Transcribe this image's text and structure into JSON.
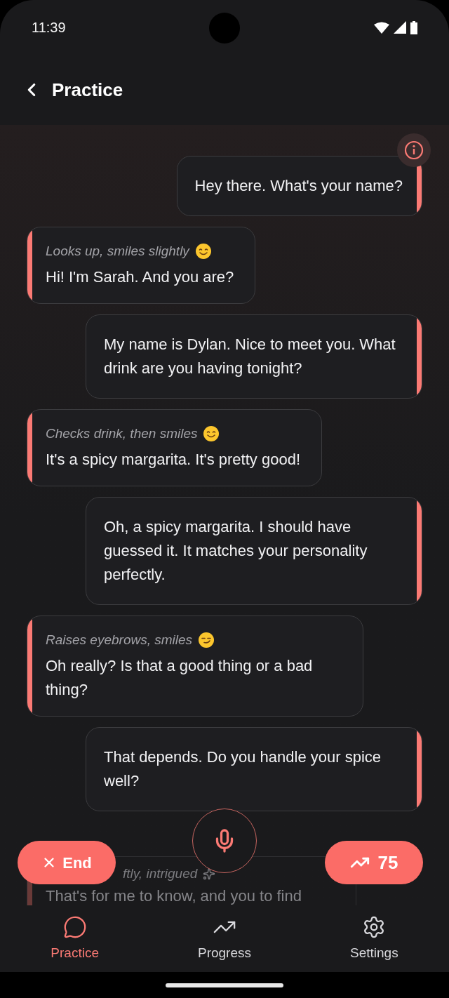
{
  "status_bar": {
    "time": "11:39"
  },
  "header": {
    "title": "Practice"
  },
  "messages": [
    {
      "kind": "sent",
      "text": "Hey there. What's your name?"
    },
    {
      "kind": "received",
      "note": {
        "kind": "smile",
        "text": "Looks up, smiles slightly"
      },
      "text": "Hi! I'm Sarah. And you are?"
    },
    {
      "kind": "sent",
      "text": "My name is Dylan. Nice to meet you. What drink are you having tonight?"
    },
    {
      "kind": "received",
      "note": {
        "kind": "smile",
        "text": "Checks drink, then smiles"
      },
      "text": "It's a spicy margarita. It's pretty good!"
    },
    {
      "kind": "sent",
      "text": "Oh, a spicy margarita. I should have guessed it. It matches your personality perfectly."
    },
    {
      "kind": "received",
      "note": {
        "kind": "smirk",
        "text": "Raises eyebrows, smiles"
      },
      "text": "Oh really? Is that a good thing or a bad thing?"
    },
    {
      "kind": "sent",
      "text": "That depends. Do you handle your spice well?"
    }
  ],
  "faded_message": {
    "note": "ftly, intrigued",
    "text": "That's for me to know, and you to find"
  },
  "controls": {
    "end_label": "End",
    "score": "75"
  },
  "nav": [
    {
      "label": "Practice",
      "kind": "chat",
      "selected": true
    },
    {
      "label": "Progress",
      "kind": "trend",
      "selected": false
    },
    {
      "label": "Settings",
      "kind": "gear",
      "selected": false
    }
  ]
}
